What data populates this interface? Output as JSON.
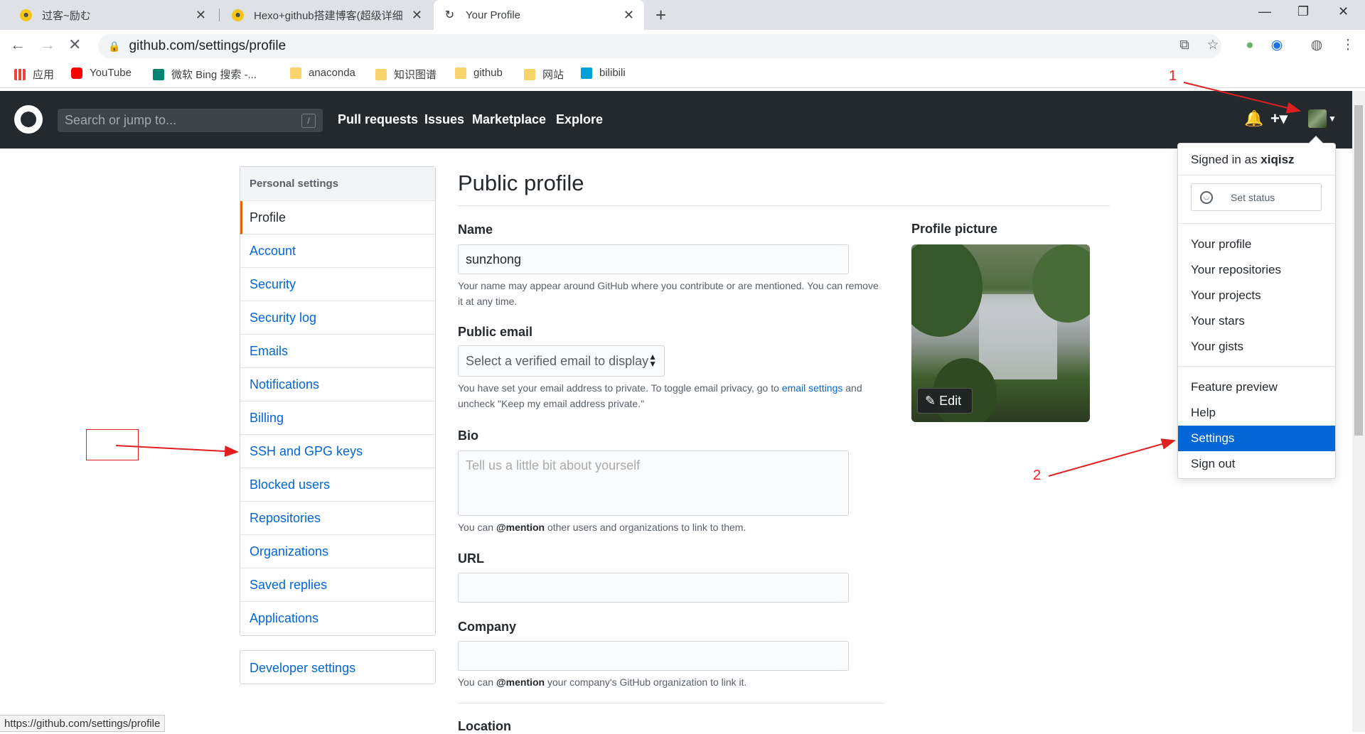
{
  "browser": {
    "tabs": [
      {
        "title": "过客~励む"
      },
      {
        "title": "Hexo+github搭建博客(超级详细"
      },
      {
        "title": "Your Profile"
      }
    ],
    "url": "github.com/settings/profile",
    "bookmarks": [
      {
        "label": "应用"
      },
      {
        "label": "YouTube"
      },
      {
        "label": "微软 Bing 搜索 -..."
      },
      {
        "label": "anaconda"
      },
      {
        "label": "知识图谱"
      },
      {
        "label": "github"
      },
      {
        "label": "网站"
      },
      {
        "label": "bilibili"
      }
    ],
    "status_url": "https://github.com/settings/profile"
  },
  "header": {
    "search_placeholder": "Search or jump to...",
    "search_shortcut": "/",
    "nav": [
      "Pull requests",
      "Issues",
      "Marketplace",
      "Explore"
    ]
  },
  "sidebar": {
    "heading": "Personal settings",
    "items": [
      "Profile",
      "Account",
      "Security",
      "Security log",
      "Emails",
      "Notifications",
      "Billing",
      "SSH and GPG keys",
      "Blocked users",
      "Repositories",
      "Organizations",
      "Saved replies",
      "Applications"
    ],
    "developer": "Developer settings"
  },
  "main": {
    "title": "Public profile",
    "name_label": "Name",
    "name_value": "sunzhong",
    "name_note": "Your name may appear around GitHub where you contribute or are mentioned. You can remove it at any time.",
    "email_label": "Public email",
    "email_select": "Select a verified email to display",
    "email_note_pre": "You have set your email address to private. To toggle email privacy, go to ",
    "email_note_link": "email settings",
    "email_note_post": " and uncheck \"Keep my email address private.\"",
    "bio_label": "Bio",
    "bio_placeholder": "Tell us a little bit about yourself",
    "bio_note_pre": "You can ",
    "bio_note_mention": "@mention",
    "bio_note_post": " other users and organizations to link to them.",
    "url_label": "URL",
    "company_label": "Company",
    "company_note_pre": "You can ",
    "company_note_mention": "@mention",
    "company_note_post": " your company's GitHub organization to link it.",
    "location_label": "Location",
    "picture_label": "Profile picture",
    "edit_label": "Edit"
  },
  "dropdown": {
    "signed_in_prefix": "Signed in as ",
    "username": "xiqisz",
    "set_status": "Set status",
    "items_a": [
      "Your profile",
      "Your repositories",
      "Your projects",
      "Your stars",
      "Your gists"
    ],
    "items_b": [
      "Feature preview",
      "Help",
      "Settings",
      "Sign out"
    ]
  },
  "annotations": {
    "one": "1",
    "two": "2"
  }
}
